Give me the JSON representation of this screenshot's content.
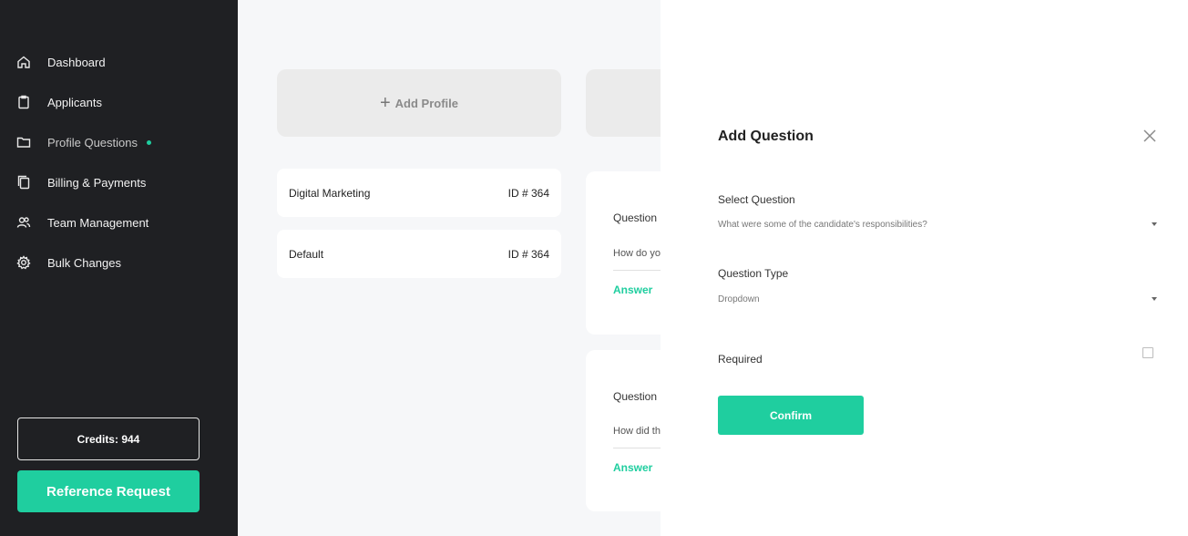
{
  "sidebar": {
    "items": [
      {
        "label": "Dashboard",
        "icon": "home-icon"
      },
      {
        "label": "Applicants",
        "icon": "clipboard-icon"
      },
      {
        "label": "Profile Questions",
        "icon": "folder-icon",
        "active": true
      },
      {
        "label": "Billing & Payments",
        "icon": "copy-icon"
      },
      {
        "label": "Team Management",
        "icon": "users-icon"
      },
      {
        "label": "Bulk Changes",
        "icon": "gear-icon"
      }
    ],
    "credits_label": "Credits: 944",
    "reference_request_label": "Reference Request"
  },
  "main": {
    "add_profile_label": "Add Profile",
    "profiles": [
      {
        "name": "Digital Marketing",
        "id_label": "ID # 364"
      },
      {
        "name": "Default",
        "id_label": "ID # 364"
      }
    ],
    "question_cards": [
      {
        "title": "Question",
        "text": "How do yo",
        "answer_label": "Answer"
      },
      {
        "title": "Question",
        "text": "How did th",
        "answer_label": "Answer"
      }
    ]
  },
  "drawer": {
    "title": "Add Question",
    "select_question_label": "Select Question",
    "select_question_value": "What were some of the candidate's responsibilities?",
    "question_type_label": "Question Type",
    "question_type_value": "Dropdown",
    "required_label": "Required",
    "required_checked": false,
    "confirm_label": "Confirm"
  },
  "colors": {
    "accent": "#1fce9f",
    "sidebar_bg": "#1f2023",
    "page_bg": "#f6f7f9"
  }
}
